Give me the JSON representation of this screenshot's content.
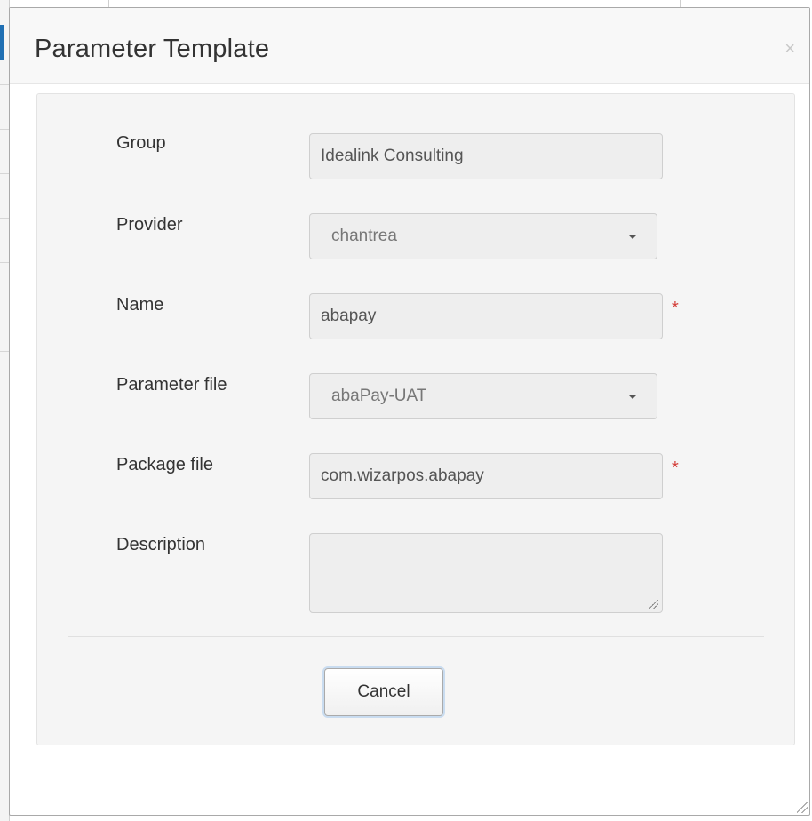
{
  "dialog": {
    "title": "Parameter Template",
    "close_label": "×"
  },
  "form": {
    "group": {
      "label": "Group",
      "value": "Idealink Consulting"
    },
    "provider": {
      "label": "Provider",
      "value": "chantrea"
    },
    "name": {
      "label": "Name",
      "value": "abapay",
      "required_mark": "*"
    },
    "parameter_file": {
      "label": "Parameter file",
      "value": "abaPay-UAT"
    },
    "package_file": {
      "label": "Package file",
      "value": "com.wizarpos.abapay",
      "required_mark": "*"
    },
    "description": {
      "label": "Description",
      "value": ""
    }
  },
  "actions": {
    "cancel_label": "Cancel"
  },
  "colors": {
    "required": "#d43f3a",
    "accent": "#1f6fb3"
  }
}
